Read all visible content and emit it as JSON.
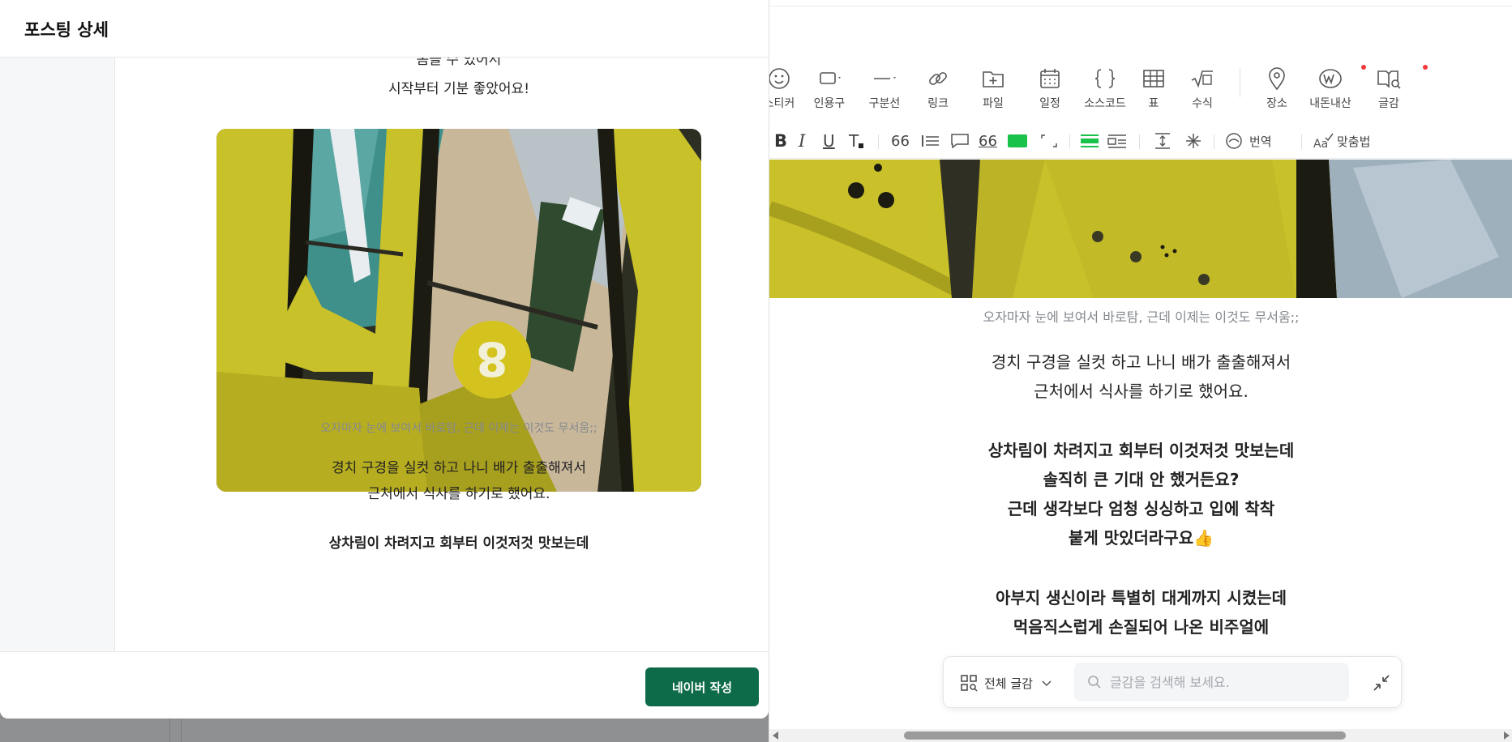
{
  "left_modal": {
    "title": "포스팅 상세",
    "text_top_partial": "봄을 수 있어서",
    "text_top": "시작부터 기분 좋았어요!",
    "photo_caption": "오자마자 눈에 보여서 바로탐, 근데 이제는 이것도 무서움;;",
    "para1_line1": "경치 구경을 실컷 하고 나니 배가 출출해져서",
    "para1_line2": "근처에서 식사를 하기로 했어요.",
    "para2_line1": "상차림이 차려지고 회부터 이것저것 맛보는데",
    "write_button": "네이버 작성"
  },
  "editor": {
    "toolbar": [
      {
        "label": "스티커",
        "icon": "sticker-icon"
      },
      {
        "label": "인용구",
        "icon": "quote-icon"
      },
      {
        "label": "구분선",
        "icon": "divider-icon"
      },
      {
        "label": "링크",
        "icon": "link-icon"
      },
      {
        "label": "파일",
        "icon": "file-icon"
      },
      {
        "label": "일정",
        "icon": "calendar-icon"
      },
      {
        "label": "소스코드",
        "icon": "code-icon"
      },
      {
        "label": "표",
        "icon": "table-icon"
      },
      {
        "label": "수식",
        "icon": "formula-icon"
      },
      {
        "label": "장소",
        "icon": "place-icon"
      },
      {
        "label": "내돈내산",
        "icon": "my-money-icon"
      },
      {
        "label": "글감",
        "icon": "material-icon"
      }
    ],
    "format": {
      "bold": "B",
      "italic": "I",
      "underline": "U",
      "font_size": "T",
      "quote_mark": "66",
      "translate": "번역",
      "spellcheck": "맞춤법"
    },
    "photo_caption": "오자마자 눈에 보여서 바로탐, 근데 이제는 이것도 무서움;;",
    "para1_line1": "경치 구경을 실컷 하고 나니 배가 출출해져서",
    "para1_line2": "근처에서 식사를 하기로 했어요.",
    "para2_line1": "상차림이 차려지고 회부터 이것저것 맛보는데",
    "para2_line2": "솔직히 큰 기대 안 했거든요?",
    "para2_line3": "근데 생각보다 엄청 싱싱하고 입에 착착",
    "para2_line4": "붙게 맛있더라구요👍",
    "para3_line1": "아부지 생신이라 특별히 대게까지 시켰는데",
    "para3_line2": "먹음직스럽게 손질되어 나온 비주얼에",
    "search": {
      "filter_label": "전체 글감",
      "placeholder": "글감을 검색해 보세요."
    }
  },
  "colors": {
    "accent_green": "#0e6b4a",
    "highlight_green": "#19c24a",
    "red_dot": "#f23a3a"
  }
}
